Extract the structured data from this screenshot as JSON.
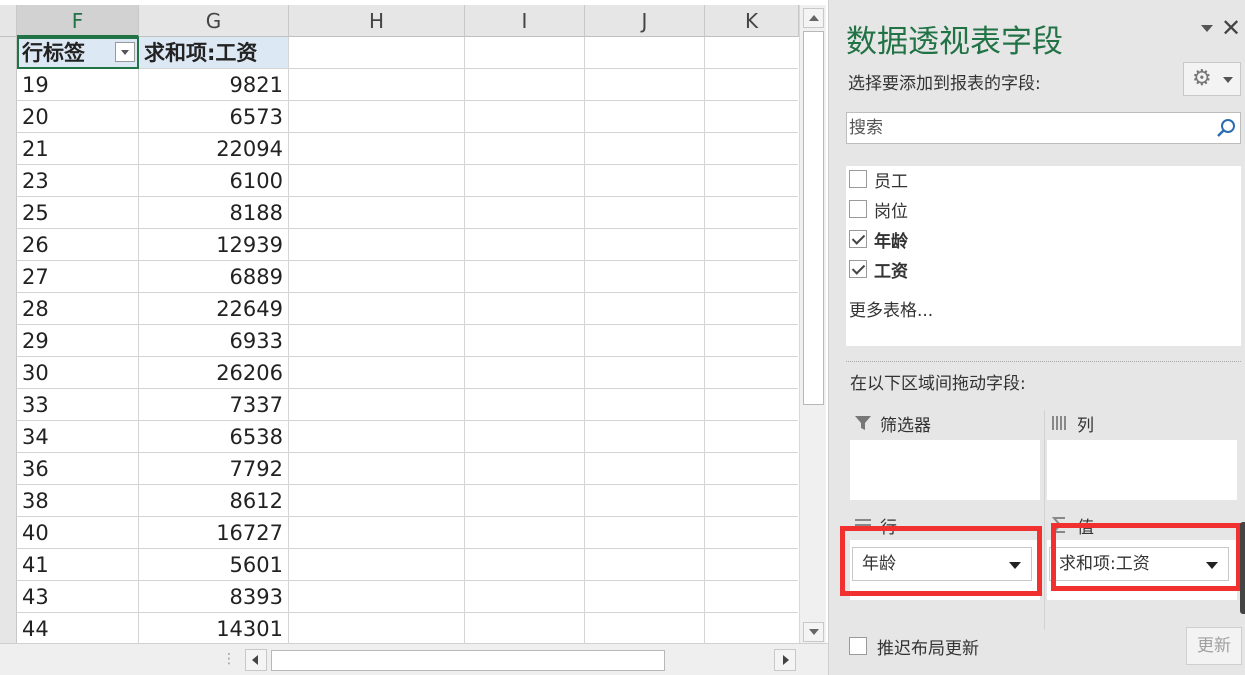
{
  "sheet": {
    "columns": [
      "F",
      "G",
      "H",
      "I",
      "J",
      "K"
    ],
    "header": {
      "row_label": "行标签",
      "sum_label": "求和项:工资"
    },
    "rows": [
      {
        "age": "19",
        "salary": "9821"
      },
      {
        "age": "20",
        "salary": "6573"
      },
      {
        "age": "21",
        "salary": "22094"
      },
      {
        "age": "23",
        "salary": "6100"
      },
      {
        "age": "25",
        "salary": "8188"
      },
      {
        "age": "26",
        "salary": "12939"
      },
      {
        "age": "27",
        "salary": "6889"
      },
      {
        "age": "28",
        "salary": "22649"
      },
      {
        "age": "29",
        "salary": "6933"
      },
      {
        "age": "30",
        "salary": "26206"
      },
      {
        "age": "33",
        "salary": "7337"
      },
      {
        "age": "34",
        "salary": "6538"
      },
      {
        "age": "36",
        "salary": "7792"
      },
      {
        "age": "38",
        "salary": "8612"
      },
      {
        "age": "40",
        "salary": "16727"
      },
      {
        "age": "41",
        "salary": "5601"
      },
      {
        "age": "43",
        "salary": "8393"
      },
      {
        "age": "44",
        "salary": "14301"
      }
    ]
  },
  "pane": {
    "title": "数据透视表字段",
    "close": "✕",
    "choose_fields_label": "选择要添加到报表的字段:",
    "search": {
      "placeholder": "搜索",
      "value": ""
    },
    "fields": [
      {
        "label": "员工",
        "checked": false
      },
      {
        "label": "岗位",
        "checked": false
      },
      {
        "label": "年龄",
        "checked": true
      },
      {
        "label": "工资",
        "checked": true
      }
    ],
    "more_tables": "更多表格...",
    "drag_label": "在以下区域间拖动字段:",
    "areas": {
      "filters": {
        "label": "筛选器"
      },
      "columns": {
        "label": "列"
      },
      "rows": {
        "label": "行",
        "item": "年龄"
      },
      "values": {
        "label": "值",
        "item": "求和项:工资"
      }
    },
    "defer_label": "推迟布局更新",
    "update_label": "更新",
    "colors": {
      "accent": "#217346",
      "highlight": "#f0312f"
    }
  }
}
